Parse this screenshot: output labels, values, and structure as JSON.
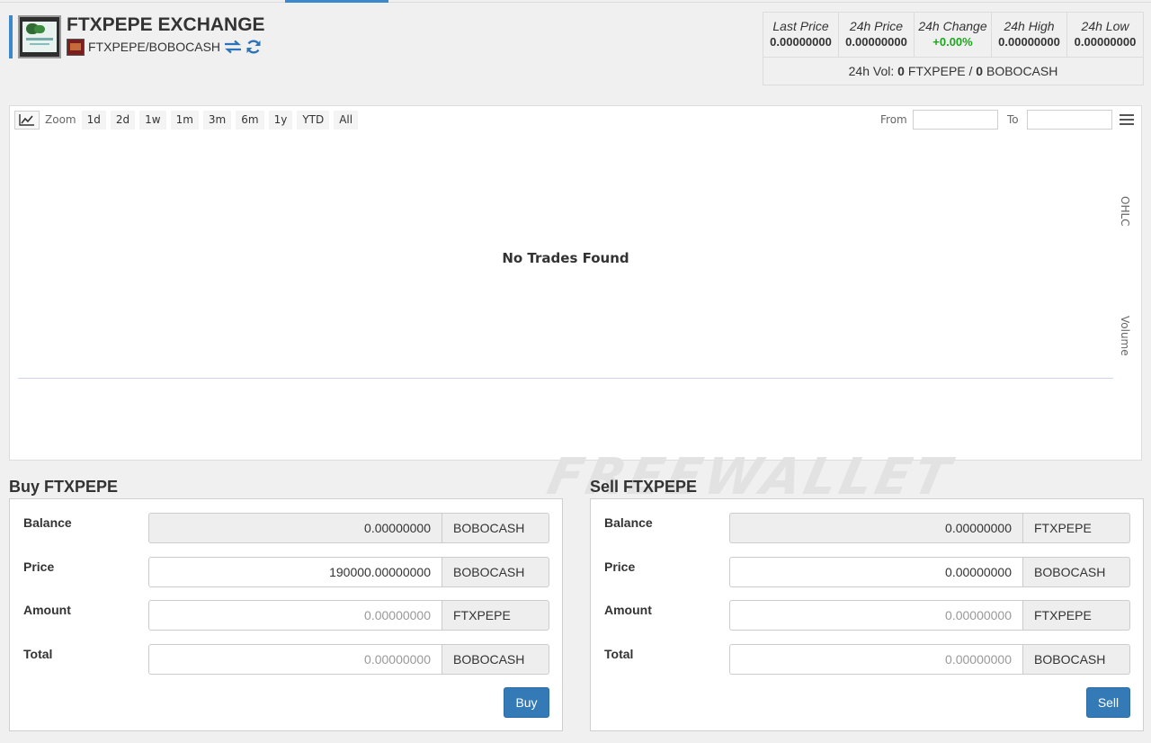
{
  "header": {
    "title": "FTXPEPE EXCHANGE",
    "pair": "FTXPEPE/BOBOCASH"
  },
  "stats": {
    "columns": [
      {
        "label": "Last Price",
        "value": "0.00000000"
      },
      {
        "label": "24h Price",
        "value": "0.00000000"
      },
      {
        "label": "24h Change",
        "value": "+0.00%"
      },
      {
        "label": "24h High",
        "value": "0.00000000"
      },
      {
        "label": "24h Low",
        "value": "0.00000000"
      }
    ],
    "volume": {
      "label": "24h Vol:",
      "base_amount": "0",
      "base_symbol": "FTXPEPE",
      "separator": "/",
      "quote_amount": "0",
      "quote_symbol": "BOBOCASH"
    },
    "change_color": "#1ea51e"
  },
  "chart": {
    "zoom_label": "Zoom",
    "zoom_buttons": [
      "1d",
      "2d",
      "1w",
      "1m",
      "3m",
      "6m",
      "1y",
      "YTD",
      "All"
    ],
    "from_label": "From",
    "to_label": "To",
    "from_value": "",
    "to_value": "",
    "message": "No Trades Found",
    "axis_labels": {
      "top": "OHLC",
      "bottom": "Volume"
    }
  },
  "watermark": "FREEWALLET",
  "buy": {
    "title": "Buy FTXPEPE",
    "rows": [
      {
        "label": "Balance",
        "value": "0.00000000",
        "unit": "BOBOCASH"
      },
      {
        "label": "Price",
        "value": "190000.00000000",
        "unit": "BOBOCASH"
      },
      {
        "label": "Amount",
        "value": "0.00000000",
        "unit": "FTXPEPE"
      },
      {
        "label": "Total",
        "value": "0.00000000",
        "unit": "BOBOCASH"
      }
    ],
    "button": "Buy"
  },
  "sell": {
    "title": "Sell FTXPEPE",
    "rows": [
      {
        "label": "Balance",
        "value": "0.00000000",
        "unit": "FTXPEPE"
      },
      {
        "label": "Price",
        "value": "0.00000000",
        "unit": "BOBOCASH"
      },
      {
        "label": "Amount",
        "value": "0.00000000",
        "unit": "FTXPEPE"
      },
      {
        "label": "Total",
        "value": "0.00000000",
        "unit": "BOBOCASH"
      }
    ],
    "button": "Sell"
  },
  "colors": {
    "accent": "#3c88cd",
    "button": "#337ab7"
  }
}
